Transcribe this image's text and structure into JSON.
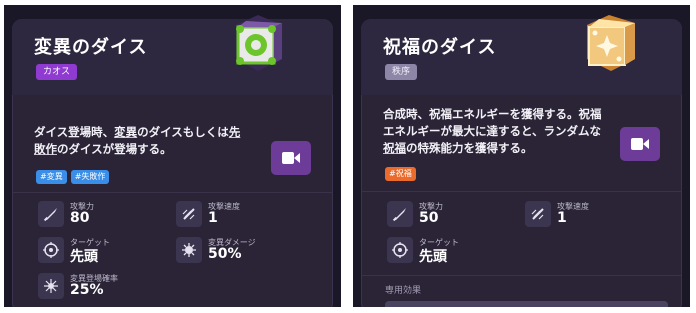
{
  "left": {
    "title": "変異のダイス",
    "tag": "カオス",
    "description": [
      {
        "text": "ダイス登場時、"
      },
      {
        "text": "変異",
        "underline": true
      },
      {
        "text": "のダイスもしくは"
      },
      {
        "text": "先敗作",
        "underline": true
      },
      {
        "text": "のダイスが登場する。"
      }
    ],
    "chips": [
      "#変異",
      "#失敗作"
    ],
    "stats": [
      {
        "label": "攻撃力",
        "value": "80",
        "icon": "sword-icon"
      },
      {
        "label": "攻撃速度",
        "value": "1",
        "icon": "speed-icon"
      },
      {
        "label": "ターゲット",
        "value": "先頭",
        "icon": "target-icon"
      },
      {
        "label": "変異ダメージ",
        "value": "50%",
        "icon": "mutation-damage-icon"
      },
      {
        "label": "変異登場確率",
        "value": "25%",
        "icon": "mutation-chance-icon"
      }
    ]
  },
  "right": {
    "title": "祝福のダイス",
    "tag": "秩序",
    "description": [
      {
        "text": "合成時、祝福エネルギーを獲得する。祝福エネルギーが最大に達すると、ランダムな"
      },
      {
        "text": "祝福",
        "underline": true
      },
      {
        "text": "の特殊能力を獲得する。"
      }
    ],
    "chips": [
      "#祝福"
    ],
    "stats": [
      {
        "label": "攻撃力",
        "value": "50",
        "icon": "sword-icon"
      },
      {
        "label": "攻撃速度",
        "value": "1",
        "icon": "speed-icon"
      },
      {
        "label": "ターゲット",
        "value": "先頭",
        "icon": "target-icon"
      }
    ],
    "section_label": "専用効果"
  },
  "colors": {
    "chaos_tag": "#8f3ad1",
    "order_tag": "#8e86a6",
    "video_button": "#6d3c98",
    "chip_blue": "#3a8ee8",
    "chip_orange": "#ea6b2c"
  }
}
